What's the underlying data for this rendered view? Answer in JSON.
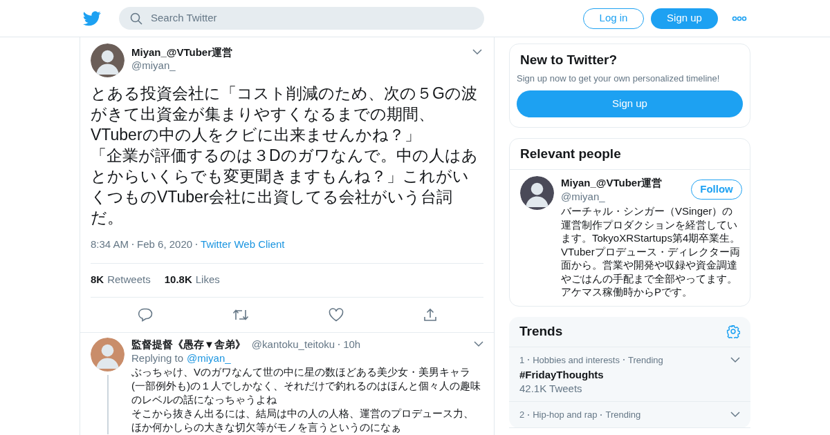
{
  "header": {
    "search": {
      "placeholder": "Search Twitter"
    },
    "buttons": [
      {
        "label": "Log in",
        "kind": "outline"
      },
      {
        "label": "Sign up",
        "kind": "filled"
      }
    ]
  },
  "tweet": {
    "name": "Miyan_@VTuber運営",
    "handle": "@miyan_",
    "paragraphs": [
      "とある投資会社に「コスト削減のため、次の５Gの波がきて出資金が集まりやすくなるまでの期間、VTuberの中の人をクビに出来ませんかね？」",
      "「企業が評価するのは３Dのガワなんで。中の人はあとからいくらでも変更聞きますもんね？」これがいくつものVTuber会社に出資してる会社がいう台詞だ。"
    ],
    "time": "8:34 AM",
    "date": "Feb 6, 2020",
    "source": "Twitter Web Client",
    "stats": [
      {
        "count": "8K",
        "label": "Retweets"
      },
      {
        "count": "10.8K",
        "label": "Likes"
      }
    ]
  },
  "reply": {
    "name": "監督提督《愚存▼舎弟》",
    "handle": "@kantoku_teitoku",
    "age": "10h",
    "replying_label": "Replying to",
    "replying_to": "@miyan_",
    "paragraphs": [
      "ぶっちゃけ、Vのガワなんて世の中に星の数ほどある美少女・美男キャラ(一部例外も)の１人でしかなく、それだけで釣れるのはほんと個々人の趣味のレベルの話になっちゃうよね",
      "そこから抜きん出るには、結局は中の人の人格、運営のプロデュース力、ほか何かしらの大きな切欠等がモノを言うというのになぁ"
    ]
  },
  "new_to_twitter": {
    "title": "New to Twitter?",
    "subtitle": "Sign up now to get your own personalized timeline!",
    "button": "Sign up"
  },
  "relevant_people": {
    "title": "Relevant people",
    "person": {
      "name": "Miyan_@VTuber運営",
      "handle": "@miyan_",
      "button": "Follow",
      "bio": "バーチャル・シンガー（VSinger）の運営制作プロダクションを経営しています。TokyoXRStartups第4期卒業生。VTuberプロデュース・ディレクター両面から。営業や開発や収録や資金調達やごはんの手配まで全部やってます。アケマス稼働時からPです。"
    }
  },
  "trends": {
    "title": "Trends",
    "items": [
      {
        "rank": "1",
        "category": "Hobbies and interests",
        "status": "Trending",
        "name": "#FridayThoughts",
        "count": "42.1K Tweets"
      },
      {
        "rank": "2",
        "category": "Hip-hop and rap",
        "status": "Trending"
      }
    ]
  }
}
